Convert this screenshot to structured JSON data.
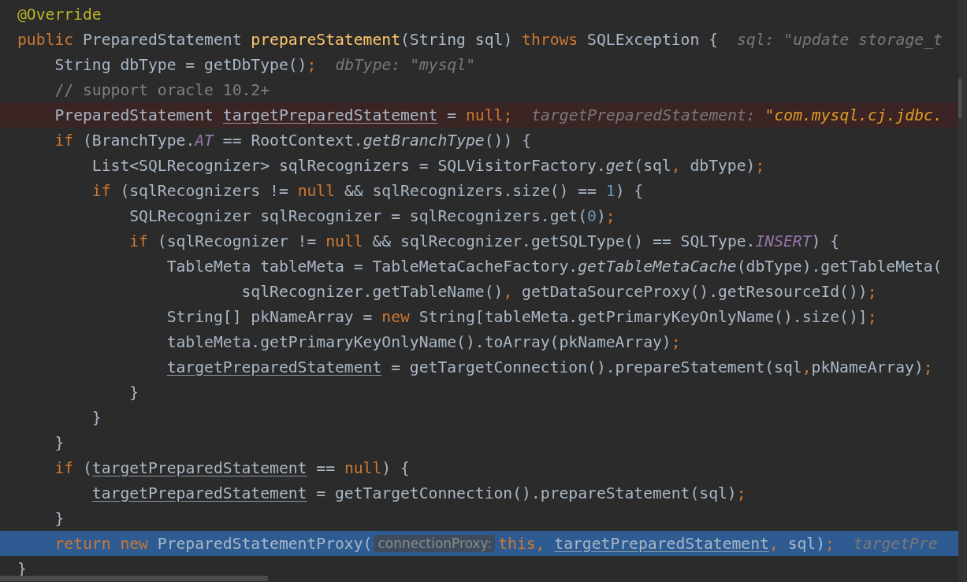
{
  "editor": {
    "lines": [
      {
        "kind": "code",
        "tokens": [
          {
            "kind": "annotation",
            "text": "@Override"
          }
        ]
      },
      {
        "kind": "code",
        "tokens": [
          {
            "kind": "keyword",
            "text": "public"
          },
          {
            "kind": "plain",
            "text": " PreparedStatement "
          },
          {
            "kind": "method_decl",
            "text": "prepareStatement"
          },
          {
            "kind": "plain",
            "text": "(String sql) "
          },
          {
            "kind": "keyword",
            "text": "throws"
          },
          {
            "kind": "plain",
            "text": " SQLException {"
          },
          {
            "kind": "hint",
            "text": "sql: \"update storage_t"
          }
        ]
      },
      {
        "kind": "code",
        "tokens": [
          {
            "kind": "plain",
            "text": "    String dbType = getDbType()"
          },
          {
            "kind": "keyword",
            "text": ";"
          },
          {
            "kind": "hint",
            "text": "dbType: \"mysql\""
          }
        ]
      },
      {
        "kind": "code",
        "tokens": [
          {
            "kind": "comment",
            "text": "    // support oracle 10.2+"
          }
        ]
      },
      {
        "kind": "breakpoint",
        "tokens": [
          {
            "kind": "plain",
            "text": "    PreparedStatement "
          },
          {
            "kind": "field",
            "text": "targetPreparedStatement"
          },
          {
            "kind": "plain",
            "text": " = "
          },
          {
            "kind": "keyword",
            "text": "null;"
          },
          {
            "kind": "hint",
            "text": "targetPreparedStatement: "
          },
          {
            "kind": "hint_value",
            "text": "\"com.mysql.cj.jdbc."
          }
        ]
      },
      {
        "kind": "code",
        "tokens": [
          {
            "kind": "keyword",
            "text": "    if"
          },
          {
            "kind": "plain",
            "text": " (BranchType."
          },
          {
            "kind": "constant",
            "text": "AT"
          },
          {
            "kind": "plain",
            "text": " == RootContext."
          },
          {
            "kind": "static",
            "text": "getBranchType"
          },
          {
            "kind": "plain",
            "text": "()) {"
          }
        ]
      },
      {
        "kind": "code",
        "tokens": [
          {
            "kind": "plain",
            "text": "        List<SQLRecognizer> sqlRecognizers = SQLVisitorFactory."
          },
          {
            "kind": "static",
            "text": "get"
          },
          {
            "kind": "plain",
            "text": "(sql"
          },
          {
            "kind": "keyword",
            "text": ","
          },
          {
            "kind": "plain",
            "text": " dbType)"
          },
          {
            "kind": "keyword",
            "text": ";"
          }
        ]
      },
      {
        "kind": "code",
        "tokens": [
          {
            "kind": "keyword",
            "text": "        if"
          },
          {
            "kind": "plain",
            "text": " (sqlRecognizers != "
          },
          {
            "kind": "keyword",
            "text": "null"
          },
          {
            "kind": "plain",
            "text": " && sqlRecognizers.size() == "
          },
          {
            "kind": "number",
            "text": "1"
          },
          {
            "kind": "plain",
            "text": ") {"
          }
        ]
      },
      {
        "kind": "code",
        "tokens": [
          {
            "kind": "plain",
            "text": "            SQLRecognizer sqlRecognizer = sqlRecognizers.get("
          },
          {
            "kind": "number",
            "text": "0"
          },
          {
            "kind": "plain",
            "text": ")"
          },
          {
            "kind": "keyword",
            "text": ";"
          }
        ]
      },
      {
        "kind": "code",
        "tokens": [
          {
            "kind": "keyword",
            "text": "            if"
          },
          {
            "kind": "plain",
            "text": " (sqlRecognizer != "
          },
          {
            "kind": "keyword",
            "text": "null"
          },
          {
            "kind": "plain",
            "text": " && sqlRecognizer.getSQLType() == SQLType."
          },
          {
            "kind": "constant",
            "text": "INSERT"
          },
          {
            "kind": "plain",
            "text": ") {"
          }
        ]
      },
      {
        "kind": "code",
        "tokens": [
          {
            "kind": "plain",
            "text": "                TableMeta tableMeta = TableMetaCacheFactory."
          },
          {
            "kind": "static",
            "text": "getTableMetaCache"
          },
          {
            "kind": "plain",
            "text": "(dbType).getTableMeta("
          }
        ]
      },
      {
        "kind": "code",
        "tokens": [
          {
            "kind": "plain",
            "text": "                        sqlRecognizer.getTableName()"
          },
          {
            "kind": "keyword",
            "text": ","
          },
          {
            "kind": "plain",
            "text": " getDataSourceProxy().getResourceId())"
          },
          {
            "kind": "keyword",
            "text": ";"
          }
        ]
      },
      {
        "kind": "code",
        "tokens": [
          {
            "kind": "plain",
            "text": "                String[] pkNameArray = "
          },
          {
            "kind": "keyword",
            "text": "new"
          },
          {
            "kind": "plain",
            "text": " String[tableMeta.getPrimaryKeyOnlyName().size()]"
          },
          {
            "kind": "keyword",
            "text": ";"
          }
        ]
      },
      {
        "kind": "code",
        "tokens": [
          {
            "kind": "plain",
            "text": "                tableMeta.getPrimaryKeyOnlyName().toArray(pkNameArray)"
          },
          {
            "kind": "keyword",
            "text": ";"
          }
        ]
      },
      {
        "kind": "code",
        "tokens": [
          {
            "kind": "field",
            "text": "                targetPreparedStatement"
          },
          {
            "kind": "plain",
            "text": " = getTargetConnection().prepareStatement(sql"
          },
          {
            "kind": "keyword",
            "text": ","
          },
          {
            "kind": "plain",
            "text": "pkNameArray)"
          },
          {
            "kind": "keyword",
            "text": ";"
          }
        ]
      },
      {
        "kind": "code",
        "tokens": [
          {
            "kind": "plain",
            "text": "            }"
          }
        ]
      },
      {
        "kind": "code",
        "tokens": [
          {
            "kind": "plain",
            "text": "        }"
          }
        ]
      },
      {
        "kind": "code",
        "tokens": [
          {
            "kind": "plain",
            "text": "    }"
          }
        ]
      },
      {
        "kind": "code",
        "tokens": [
          {
            "kind": "keyword",
            "text": "    if"
          },
          {
            "kind": "plain",
            "text": " ("
          },
          {
            "kind": "field",
            "text": "targetPreparedStatement"
          },
          {
            "kind": "plain",
            "text": " == "
          },
          {
            "kind": "keyword",
            "text": "null"
          },
          {
            "kind": "plain",
            "text": ") {"
          }
        ]
      },
      {
        "kind": "code",
        "tokens": [
          {
            "kind": "field",
            "text": "        targetPreparedStatement"
          },
          {
            "kind": "plain",
            "text": " = getTargetConnection().prepareStatement(sql)"
          },
          {
            "kind": "keyword",
            "text": ";"
          }
        ]
      },
      {
        "kind": "code",
        "tokens": [
          {
            "kind": "plain",
            "text": "    }"
          }
        ]
      },
      {
        "kind": "execution",
        "tokens": [
          {
            "kind": "keyword",
            "text": "    return new"
          },
          {
            "kind": "plain",
            "text": " PreparedStatementProxy("
          },
          {
            "kind": "param_hint",
            "text": "connectionProxy:"
          },
          {
            "kind": "keyword",
            "text": "this, "
          },
          {
            "kind": "field",
            "text": "targetPreparedStatement"
          },
          {
            "kind": "keyword",
            "text": ","
          },
          {
            "kind": "plain",
            "text": " sql)"
          },
          {
            "kind": "keyword",
            "text": ";"
          },
          {
            "kind": "hint",
            "text": "targetPre"
          }
        ]
      },
      {
        "kind": "code",
        "tokens": [
          {
            "kind": "plain",
            "text": "}"
          }
        ]
      }
    ]
  }
}
